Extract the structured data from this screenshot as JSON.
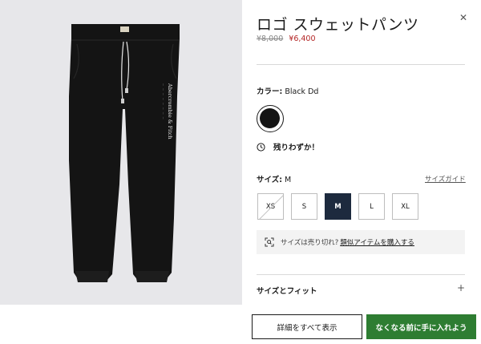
{
  "product": {
    "title": "ロゴ スウェットパンツ",
    "price_old": "¥8,000",
    "price_new": "¥6,400",
    "image_brand_text": "Abercrombie & Fitch"
  },
  "color": {
    "label": "カラー:",
    "value": "Black Dd",
    "swatch_hex": "#141414"
  },
  "stock": {
    "text": "残りわずか！"
  },
  "size": {
    "label": "サイズ:",
    "value": "M",
    "guide_link": "サイズガイド",
    "options": [
      {
        "label": "XS",
        "state": "sold-out"
      },
      {
        "label": "S",
        "state": "available"
      },
      {
        "label": "M",
        "state": "selected"
      },
      {
        "label": "L",
        "state": "available"
      },
      {
        "label": "XL",
        "state": "available"
      }
    ]
  },
  "soldout_notice": {
    "text": "サイズは売り切れ?",
    "link": "類似アイテムを購入する"
  },
  "accordion": {
    "size_fit": "サイズとフィット",
    "expand_symbol": "+"
  },
  "actions": {
    "details": "詳細をすべて表示",
    "add_to_cart": "なくなる前に手に入れよう"
  },
  "colors": {
    "selected_size_bg": "#1d2a3e",
    "cart_button": "#2e7d32",
    "sale_price": "#b32424",
    "image_bg": "#e7e7ea"
  }
}
